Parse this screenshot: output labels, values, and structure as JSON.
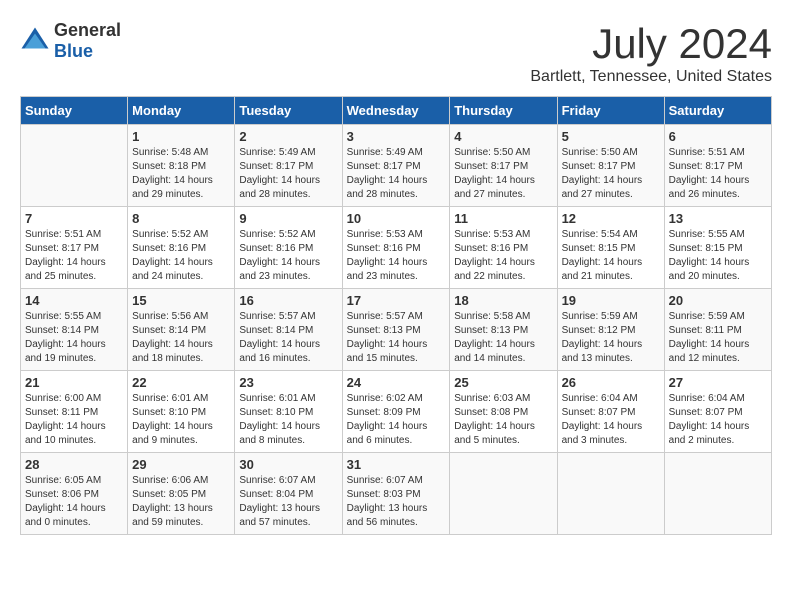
{
  "header": {
    "logo_general": "General",
    "logo_blue": "Blue",
    "month_title": "July 2024",
    "location": "Bartlett, Tennessee, United States"
  },
  "calendar": {
    "days_of_week": [
      "Sunday",
      "Monday",
      "Tuesday",
      "Wednesday",
      "Thursday",
      "Friday",
      "Saturday"
    ],
    "weeks": [
      [
        {
          "day": "",
          "info": ""
        },
        {
          "day": "1",
          "info": "Sunrise: 5:48 AM\nSunset: 8:18 PM\nDaylight: 14 hours\nand 29 minutes."
        },
        {
          "day": "2",
          "info": "Sunrise: 5:49 AM\nSunset: 8:17 PM\nDaylight: 14 hours\nand 28 minutes."
        },
        {
          "day": "3",
          "info": "Sunrise: 5:49 AM\nSunset: 8:17 PM\nDaylight: 14 hours\nand 28 minutes."
        },
        {
          "day": "4",
          "info": "Sunrise: 5:50 AM\nSunset: 8:17 PM\nDaylight: 14 hours\nand 27 minutes."
        },
        {
          "day": "5",
          "info": "Sunrise: 5:50 AM\nSunset: 8:17 PM\nDaylight: 14 hours\nand 27 minutes."
        },
        {
          "day": "6",
          "info": "Sunrise: 5:51 AM\nSunset: 8:17 PM\nDaylight: 14 hours\nand 26 minutes."
        }
      ],
      [
        {
          "day": "7",
          "info": "Sunrise: 5:51 AM\nSunset: 8:17 PM\nDaylight: 14 hours\nand 25 minutes."
        },
        {
          "day": "8",
          "info": "Sunrise: 5:52 AM\nSunset: 8:16 PM\nDaylight: 14 hours\nand 24 minutes."
        },
        {
          "day": "9",
          "info": "Sunrise: 5:52 AM\nSunset: 8:16 PM\nDaylight: 14 hours\nand 23 minutes."
        },
        {
          "day": "10",
          "info": "Sunrise: 5:53 AM\nSunset: 8:16 PM\nDaylight: 14 hours\nand 23 minutes."
        },
        {
          "day": "11",
          "info": "Sunrise: 5:53 AM\nSunset: 8:16 PM\nDaylight: 14 hours\nand 22 minutes."
        },
        {
          "day": "12",
          "info": "Sunrise: 5:54 AM\nSunset: 8:15 PM\nDaylight: 14 hours\nand 21 minutes."
        },
        {
          "day": "13",
          "info": "Sunrise: 5:55 AM\nSunset: 8:15 PM\nDaylight: 14 hours\nand 20 minutes."
        }
      ],
      [
        {
          "day": "14",
          "info": "Sunrise: 5:55 AM\nSunset: 8:14 PM\nDaylight: 14 hours\nand 19 minutes."
        },
        {
          "day": "15",
          "info": "Sunrise: 5:56 AM\nSunset: 8:14 PM\nDaylight: 14 hours\nand 18 minutes."
        },
        {
          "day": "16",
          "info": "Sunrise: 5:57 AM\nSunset: 8:14 PM\nDaylight: 14 hours\nand 16 minutes."
        },
        {
          "day": "17",
          "info": "Sunrise: 5:57 AM\nSunset: 8:13 PM\nDaylight: 14 hours\nand 15 minutes."
        },
        {
          "day": "18",
          "info": "Sunrise: 5:58 AM\nSunset: 8:13 PM\nDaylight: 14 hours\nand 14 minutes."
        },
        {
          "day": "19",
          "info": "Sunrise: 5:59 AM\nSunset: 8:12 PM\nDaylight: 14 hours\nand 13 minutes."
        },
        {
          "day": "20",
          "info": "Sunrise: 5:59 AM\nSunset: 8:11 PM\nDaylight: 14 hours\nand 12 minutes."
        }
      ],
      [
        {
          "day": "21",
          "info": "Sunrise: 6:00 AM\nSunset: 8:11 PM\nDaylight: 14 hours\nand 10 minutes."
        },
        {
          "day": "22",
          "info": "Sunrise: 6:01 AM\nSunset: 8:10 PM\nDaylight: 14 hours\nand 9 minutes."
        },
        {
          "day": "23",
          "info": "Sunrise: 6:01 AM\nSunset: 8:10 PM\nDaylight: 14 hours\nand 8 minutes."
        },
        {
          "day": "24",
          "info": "Sunrise: 6:02 AM\nSunset: 8:09 PM\nDaylight: 14 hours\nand 6 minutes."
        },
        {
          "day": "25",
          "info": "Sunrise: 6:03 AM\nSunset: 8:08 PM\nDaylight: 14 hours\nand 5 minutes."
        },
        {
          "day": "26",
          "info": "Sunrise: 6:04 AM\nSunset: 8:07 PM\nDaylight: 14 hours\nand 3 minutes."
        },
        {
          "day": "27",
          "info": "Sunrise: 6:04 AM\nSunset: 8:07 PM\nDaylight: 14 hours\nand 2 minutes."
        }
      ],
      [
        {
          "day": "28",
          "info": "Sunrise: 6:05 AM\nSunset: 8:06 PM\nDaylight: 14 hours\nand 0 minutes."
        },
        {
          "day": "29",
          "info": "Sunrise: 6:06 AM\nSunset: 8:05 PM\nDaylight: 13 hours\nand 59 minutes."
        },
        {
          "day": "30",
          "info": "Sunrise: 6:07 AM\nSunset: 8:04 PM\nDaylight: 13 hours\nand 57 minutes."
        },
        {
          "day": "31",
          "info": "Sunrise: 6:07 AM\nSunset: 8:03 PM\nDaylight: 13 hours\nand 56 minutes."
        },
        {
          "day": "",
          "info": ""
        },
        {
          "day": "",
          "info": ""
        },
        {
          "day": "",
          "info": ""
        }
      ]
    ]
  }
}
